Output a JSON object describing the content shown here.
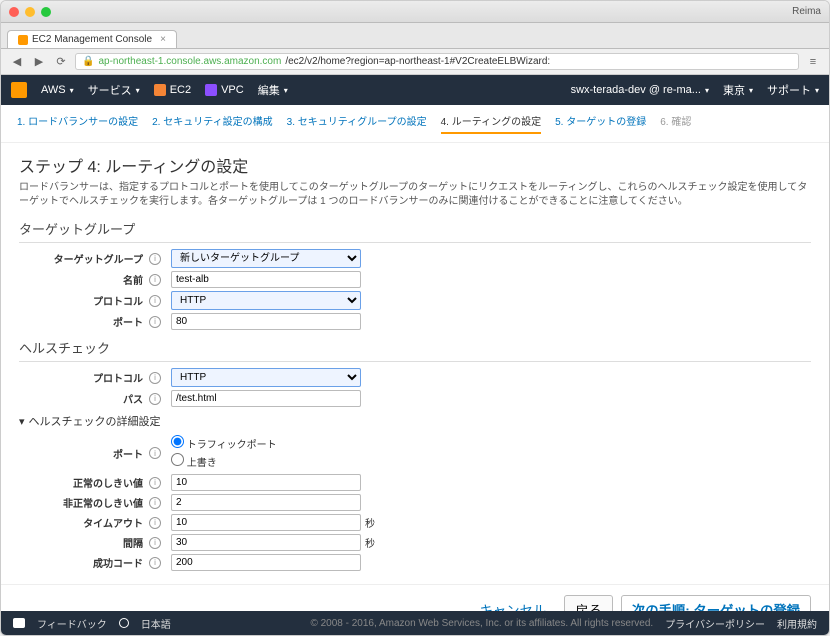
{
  "browser": {
    "tab_title": "EC2 Management Console",
    "user": "Reima",
    "url_domain": "ap-northeast-1.console.aws.amazon.com",
    "url_path": "/ec2/v2/home?region=ap-northeast-1#V2CreateELBWizard:"
  },
  "nav": {
    "aws": "AWS",
    "services": "サービス",
    "ec2": "EC2",
    "vpc": "VPC",
    "edit": "編集",
    "account": "swx-terada-dev @ re-ma...",
    "region": "東京",
    "support": "サポート"
  },
  "steps": {
    "s1": "1. ロードバランサーの設定",
    "s2": "2. セキュリティ設定の構成",
    "s3": "3. セキュリティグループの設定",
    "s4": "4. ルーティングの設定",
    "s5": "5. ターゲットの登録",
    "s6": "6. 確認"
  },
  "page": {
    "title": "ステップ 4: ルーティングの設定",
    "desc": "ロードバランサーは、指定するプロトコルとポートを使用してこのターゲットグループのターゲットにリクエストをルーティングし、これらのヘルスチェック設定を使用してターゲットでヘルスチェックを実行します。各ターゲットグループは 1 つのロードバランサーのみに関連付けることができることに注意してください。"
  },
  "section": {
    "target_group": "ターゲットグループ",
    "health_check": "ヘルスチェック",
    "advanced": "ヘルスチェックの詳細設定"
  },
  "fields": {
    "target_group_label": "ターゲットグループ",
    "target_group_value": "新しいターゲットグループ",
    "name_label": "名前",
    "name_value": "test-alb",
    "protocol_label": "プロトコル",
    "protocol_value": "HTTP",
    "port_label": "ポート",
    "port_value": "80",
    "hc_protocol_label": "プロトコル",
    "hc_protocol_value": "HTTP",
    "path_label": "パス",
    "path_value": "/test.html",
    "hc_port_label": "ポート",
    "hc_port_opt1": "トラフィックポート",
    "hc_port_opt2": "上書き",
    "healthy_label": "正常のしきい値",
    "healthy_value": "10",
    "unhealthy_label": "非正常のしきい値",
    "unhealthy_value": "2",
    "timeout_label": "タイムアウト",
    "timeout_value": "10",
    "interval_label": "間隔",
    "interval_value": "30",
    "success_label": "成功コード",
    "success_value": "200",
    "seconds": "秒"
  },
  "actions": {
    "cancel": "キャンセル",
    "back": "戻る",
    "next": "次の手順: ターゲットの登録"
  },
  "footer": {
    "feedback": "フィードバック",
    "lang": "日本語",
    "copy": "© 2008 - 2016, Amazon Web Services, Inc. or its affiliates. All rights reserved.",
    "privacy": "プライバシーポリシー",
    "terms": "利用規約"
  }
}
